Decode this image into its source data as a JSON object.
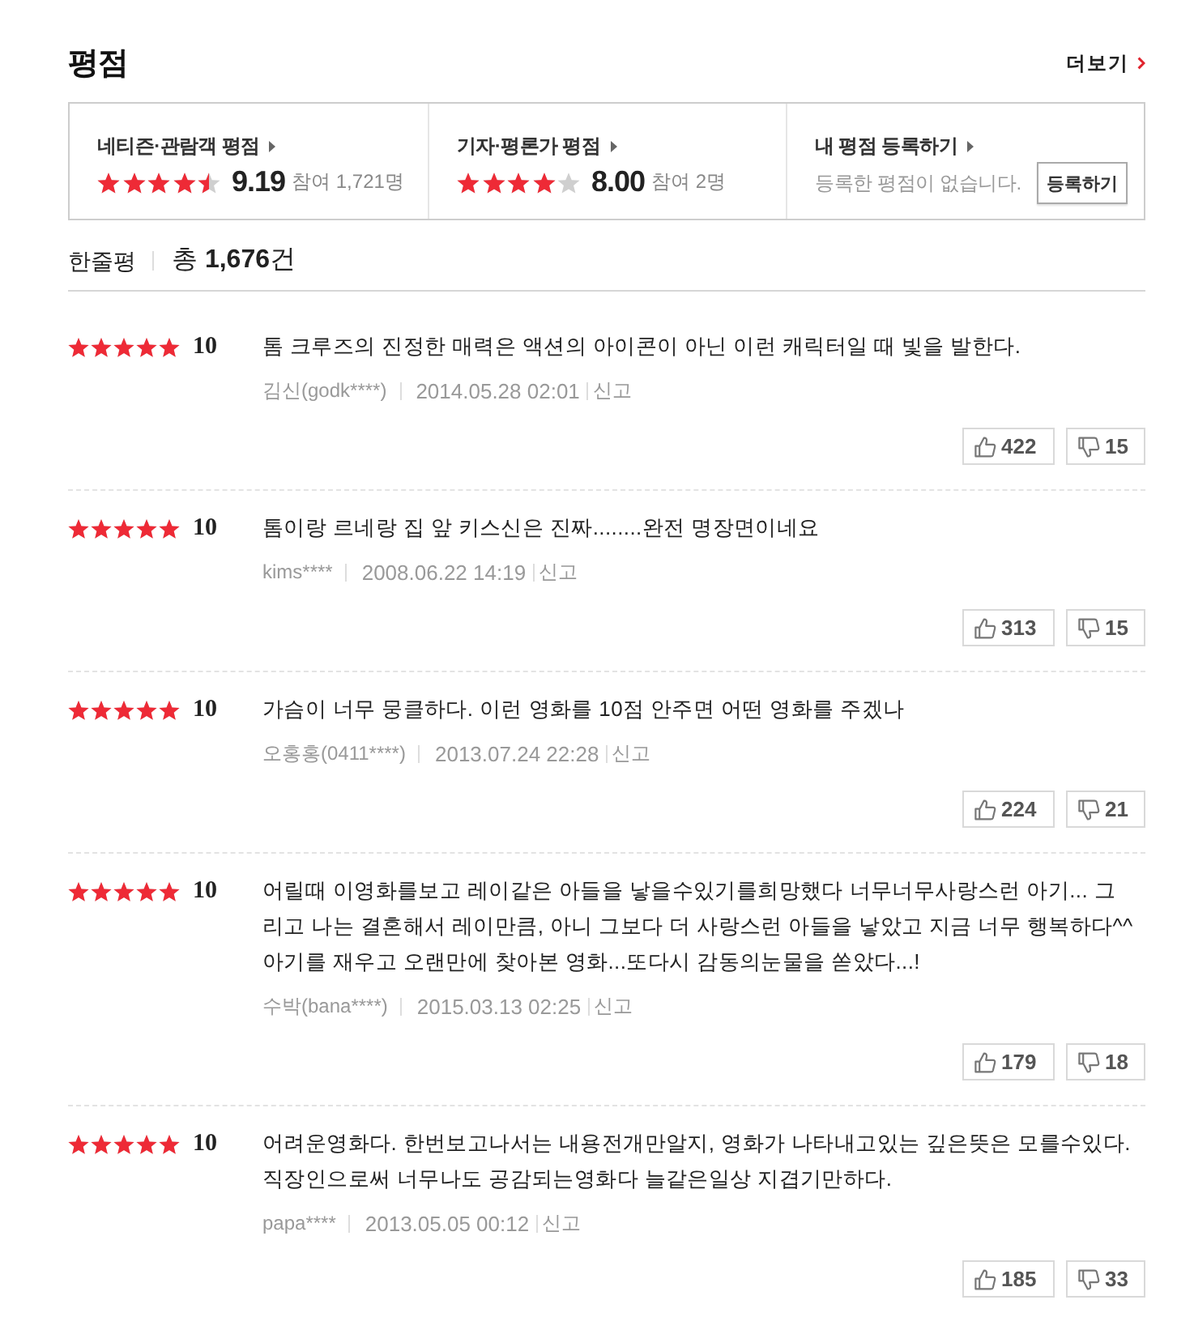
{
  "section": {
    "title": "평점",
    "more_link": "더보기"
  },
  "summary": [
    {
      "kind": "score",
      "label": "네티즌·관람객 평점",
      "stars": 4.5,
      "score": "9.19",
      "participants": "참여 1,721명"
    },
    {
      "kind": "score",
      "label": "기자·평론가 평점",
      "stars": 4,
      "score": "8.00",
      "participants": "참여 2명"
    },
    {
      "kind": "register",
      "label": "내 평점 등록하기",
      "message": "등록한 평점이 없습니다.",
      "button": "등록하기"
    }
  ],
  "comments_header": {
    "title": "한줄평",
    "total": "총 **1,676**건"
  },
  "reviews": [
    {
      "stars": 5,
      "score": "10",
      "text": "톰 크루즈의 진정한 매력은 액션의 아이콘이 아닌 이런 캐릭터일 때 빛을 발한다.",
      "author": "김신(godk****)",
      "date": "2014.05.28 02:01",
      "report": "신고",
      "likes": "422",
      "dislikes": "15"
    },
    {
      "stars": 5,
      "score": "10",
      "text": "톰이랑 르네랑 집 앞 키스신은 진짜........완전 명장면이네요",
      "author": "kims****",
      "date": "2008.06.22 14:19",
      "report": "신고",
      "likes": "313",
      "dislikes": "15"
    },
    {
      "stars": 5,
      "score": "10",
      "text": "가슴이 너무 뭉클하다. 이런 영화를 10점 안주면 어떤 영화를 주겠나",
      "author": "오홍홍(0411****)",
      "date": "2013.07.24 22:28",
      "report": "신고",
      "likes": "224",
      "dislikes": "21"
    },
    {
      "stars": 5,
      "score": "10",
      "text": "어릴때 이영화를보고 레이같은 아들을 낳을수있기를희망했다 너무너무사랑스런 아기... 그리고 나는 결혼해서 레이만큼, 아니 그보다 더 사랑스런 아들을 낳았고 지금 너무 행복하다^^ 아기를 재우고 오랜만에 찾아본 영화...또다시 감동의눈물을 쏟았다...!",
      "author": "수박(bana****)",
      "date": "2015.03.13 02:25",
      "report": "신고",
      "likes": "179",
      "dislikes": "18"
    },
    {
      "stars": 5,
      "score": "10",
      "text": "어려운영화다. 한번보고나서는 내용전개만알지, 영화가 나타내고있는 깊은뜻은 모를수있다. 직장인으로써 너무나도 공감되는영화다 늘같은일상 지겹기만하다.",
      "author": "papa****",
      "date": "2013.05.05 00:12",
      "report": "신고",
      "likes": "185",
      "dislikes": "33"
    }
  ]
}
